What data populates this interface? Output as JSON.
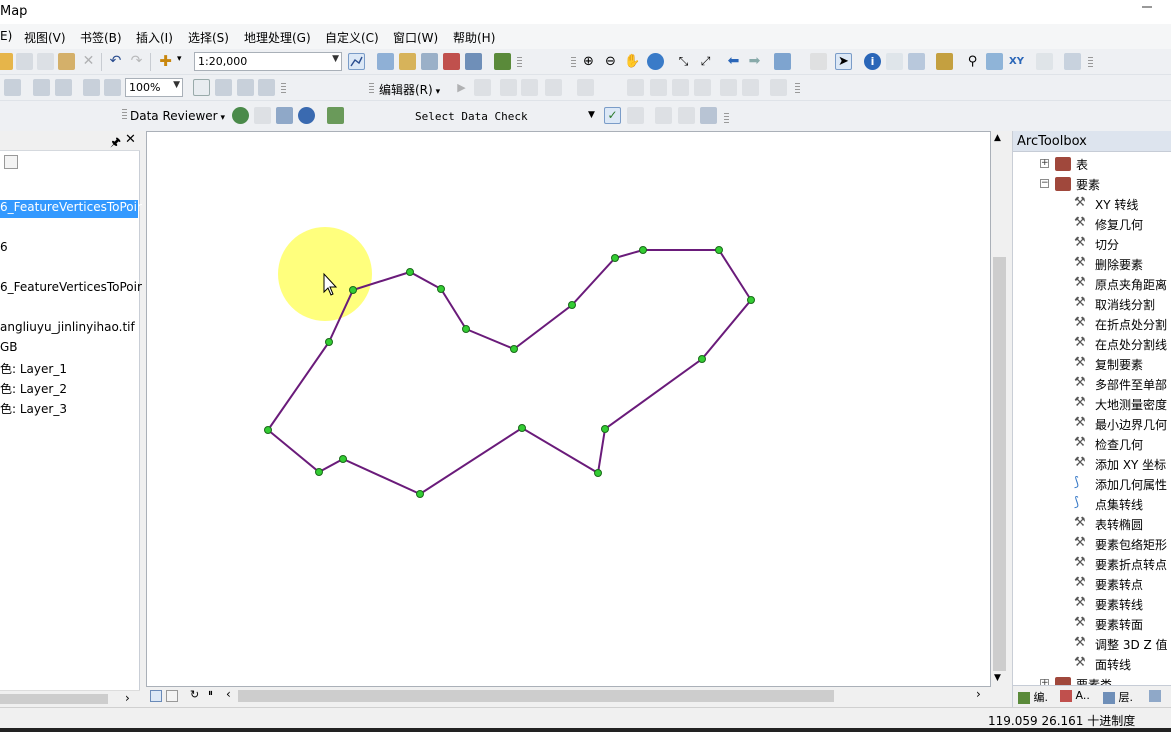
{
  "app": {
    "title": "Map"
  },
  "menubar": {
    "items": [
      "E)",
      "视图(V)",
      "书签(B)",
      "插入(I)",
      "选择(S)",
      "地理处理(G)",
      "自定义(C)",
      "窗口(W)",
      "帮助(H)"
    ]
  },
  "toolbar": {
    "scale_value": "1:20,000",
    "zoom_value": "100%",
    "editor_label": "编辑器(R)",
    "data_reviewer_label": "Data Reviewer",
    "select_data_check_label": "Select Data Check"
  },
  "toc": {
    "items": [
      {
        "text": "6_FeatureVerticesToPoir",
        "selected": true
      },
      {
        "text": "6",
        "selected": false
      },
      {
        "text": "6_FeatureVerticesToPoir",
        "selected": false
      },
      {
        "text": "angliuyu_jinlinyihao.tif",
        "selected": false
      },
      {
        "text": "GB",
        "selected": false
      },
      {
        "text": "色:    Layer_1",
        "selected": false
      },
      {
        "text": "色: Layer_2",
        "selected": false
      },
      {
        "text": "色:    Layer_3",
        "selected": false
      }
    ]
  },
  "map": {
    "polygon_color": "#6a1b7a",
    "vertex_color": "#33cc33",
    "highlight_color": "#ffff66"
  },
  "arctoolbox": {
    "title": "ArcToolbox",
    "items": [
      {
        "text": "表",
        "type": "toolset",
        "expander": "+"
      },
      {
        "text": "要素",
        "type": "toolset",
        "expander": "−"
      },
      {
        "text": "XY 转线",
        "type": "tool"
      },
      {
        "text": "修复几何",
        "type": "tool"
      },
      {
        "text": "切分",
        "type": "tool"
      },
      {
        "text": "删除要素",
        "type": "tool"
      },
      {
        "text": "原点夹角距离",
        "type": "tool"
      },
      {
        "text": "取消线分割",
        "type": "tool"
      },
      {
        "text": "在折点处分割",
        "type": "tool"
      },
      {
        "text": "在点处分割线",
        "type": "tool"
      },
      {
        "text": "复制要素",
        "type": "tool"
      },
      {
        "text": "多部件至单部",
        "type": "tool"
      },
      {
        "text": "大地测量密度",
        "type": "tool"
      },
      {
        "text": "最小边界几何",
        "type": "tool"
      },
      {
        "text": "检查几何",
        "type": "tool"
      },
      {
        "text": "添加 XY 坐标",
        "type": "tool"
      },
      {
        "text": "添加几何属性",
        "type": "script"
      },
      {
        "text": "点集转线",
        "type": "script"
      },
      {
        "text": "表转椭圆",
        "type": "tool"
      },
      {
        "text": "要素包络矩形",
        "type": "tool"
      },
      {
        "text": "要素折点转点",
        "type": "tool"
      },
      {
        "text": "要素转点",
        "type": "tool"
      },
      {
        "text": "要素转线",
        "type": "tool"
      },
      {
        "text": "要素转面",
        "type": "tool"
      },
      {
        "text": "调整 3D Z 值",
        "type": "tool"
      },
      {
        "text": "面转线",
        "type": "tool"
      },
      {
        "text": "要素类",
        "type": "toolset",
        "expander": "+"
      }
    ],
    "tabs": [
      "编.",
      "A..",
      "层.",
      ""
    ]
  },
  "status": {
    "coordinates": "119.059  26.161 十进制度"
  }
}
